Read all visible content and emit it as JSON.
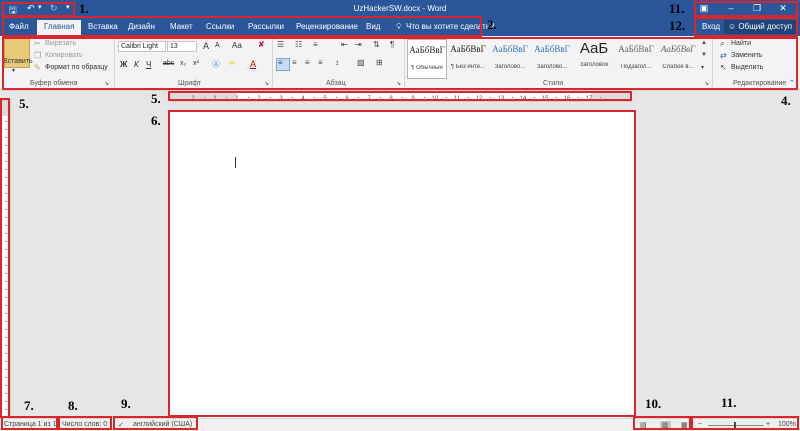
{
  "window": {
    "title": "UzHackerSW.docx - Word",
    "qat": {
      "save_icon": "save-icon",
      "undo_icon": "undo-icon",
      "redo_icon": "redo-icon",
      "customize_icon": "customize-qat-icon"
    },
    "controls": {
      "ribbon_options": "ribbon-display-options-icon",
      "minimize": "minimize-icon",
      "restore": "restore-icon",
      "close": "close-icon"
    }
  },
  "tabs": [
    {
      "label": "Файл"
    },
    {
      "label": "Главная"
    },
    {
      "label": "Вставка"
    },
    {
      "label": "Дизайн"
    },
    {
      "label": "Макет"
    },
    {
      "label": "Ссылки"
    },
    {
      "label": "Рассылки"
    },
    {
      "label": "Рецензирование"
    },
    {
      "label": "Вид"
    }
  ],
  "tell_me": "Что вы хотите сделать?",
  "account": {
    "signin": "Вход",
    "share": "Общий доступ"
  },
  "ribbon": {
    "clipboard": {
      "label": "Буфер обмена",
      "paste": "Вставить",
      "cut": "Вырезать",
      "copy": "Копировать",
      "format_painter": "Формат по образцу"
    },
    "font": {
      "label": "Шрифт",
      "family": "Calibri Light",
      "size": "13",
      "grow": "A",
      "shrink": "A",
      "case": "Aa",
      "bold": "Ж",
      "italic": "К",
      "underline": "Ч",
      "strike": "abc",
      "subscript": "x₂",
      "superscript": "x²",
      "font_color": "A"
    },
    "paragraph": {
      "label": "Абзац"
    },
    "styles": {
      "label": "Стили",
      "items": [
        {
          "preview": "АаБбВвГ",
          "name": "¶ Обычный"
        },
        {
          "preview": "АаБбВвГ",
          "name": "¶ Без инте..."
        },
        {
          "preview": "АаБбВвГ",
          "name": "Заголово..."
        },
        {
          "preview": "АаБбВвГ",
          "name": "Заголово..."
        },
        {
          "preview": "АаБ",
          "name": "Заголовок"
        },
        {
          "preview": "АаБбВвГ",
          "name": "Подзагол..."
        },
        {
          "preview": "АаБбВвГ",
          "name": "Слабое в..."
        }
      ]
    },
    "editing": {
      "label": "Редактирование",
      "find": "Найти",
      "replace": "Заменить",
      "select": "Выделить"
    }
  },
  "ruler": {
    "h_ticks": [
      "2",
      "1",
      "1",
      "2",
      "3",
      "4",
      "5",
      "6",
      "7",
      "8",
      "9",
      "10",
      "11",
      "12",
      "13",
      "14",
      "15",
      "16",
      "17"
    ]
  },
  "status": {
    "page": "Страница 1 из 1",
    "words": "Число слов: 0",
    "language": "английский (США)",
    "zoom": "100%"
  },
  "annotations": {
    "n1": "1.",
    "n2": "2.",
    "n4": "4.",
    "n5a": "5.",
    "n5b": "5.",
    "n6": "6.",
    "n7": "7.",
    "n8": "8.",
    "n9": "9.",
    "n10": "10.",
    "n11a": "11.",
    "n11b": "11.",
    "n12": "12."
  },
  "colors": {
    "accent": "#2b579a",
    "highlight": "#d9262c",
    "ribbon_bg": "#f3f3f3",
    "canvas_bg": "#e6e6e6"
  }
}
